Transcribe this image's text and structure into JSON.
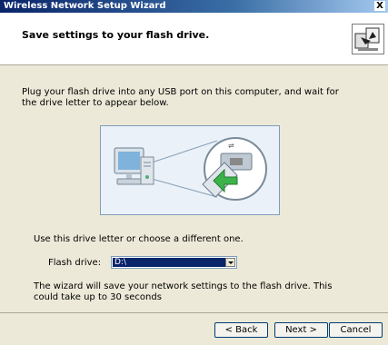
{
  "window": {
    "title": "Wireless Network Setup Wizard",
    "close_label": "X"
  },
  "header": {
    "title": "Save settings to your flash drive."
  },
  "content": {
    "instruction": "Plug your flash drive into any USB port on this computer, and wait for the drive letter to appear below.",
    "choose_text": "Use this drive letter or choose a different one.",
    "flash_drive_label": "Flash drive:",
    "flash_drive_value": "D:\\",
    "note": "The wizard will save your network settings to the flash drive. This could take up to 30 seconds"
  },
  "buttons": {
    "back": "< Back",
    "next": "Next >",
    "cancel": "Cancel"
  },
  "colors": {
    "titlebar": "#0a246a",
    "dialog_bg": "#ece9d8",
    "selection": "#0a246a",
    "arrow_green": "#3cb34a"
  }
}
